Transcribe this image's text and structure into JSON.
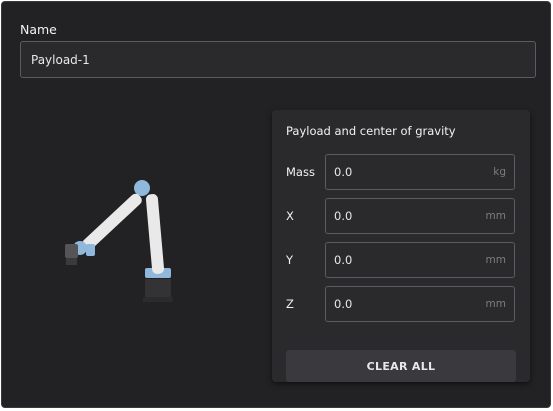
{
  "name": {
    "label": "Name",
    "value": "Payload-1"
  },
  "payload": {
    "title": "Payload and center of gravity",
    "fields": [
      {
        "label": "Mass",
        "value": "0.0",
        "unit": "kg"
      },
      {
        "label": "X",
        "value": "0.0",
        "unit": "mm"
      },
      {
        "label": "Y",
        "value": "0.0",
        "unit": "mm"
      },
      {
        "label": "Z",
        "value": "0.0",
        "unit": "mm"
      }
    ],
    "clear_label": "CLEAR ALL"
  },
  "colors": {
    "background": "#222224",
    "panel": "#2a2a2d",
    "border": "#5c5c60",
    "joint_blue": "#8fb8dc",
    "robot_white": "#e9e9e9"
  },
  "icons": {
    "robot": "robot-arm-illustration"
  }
}
